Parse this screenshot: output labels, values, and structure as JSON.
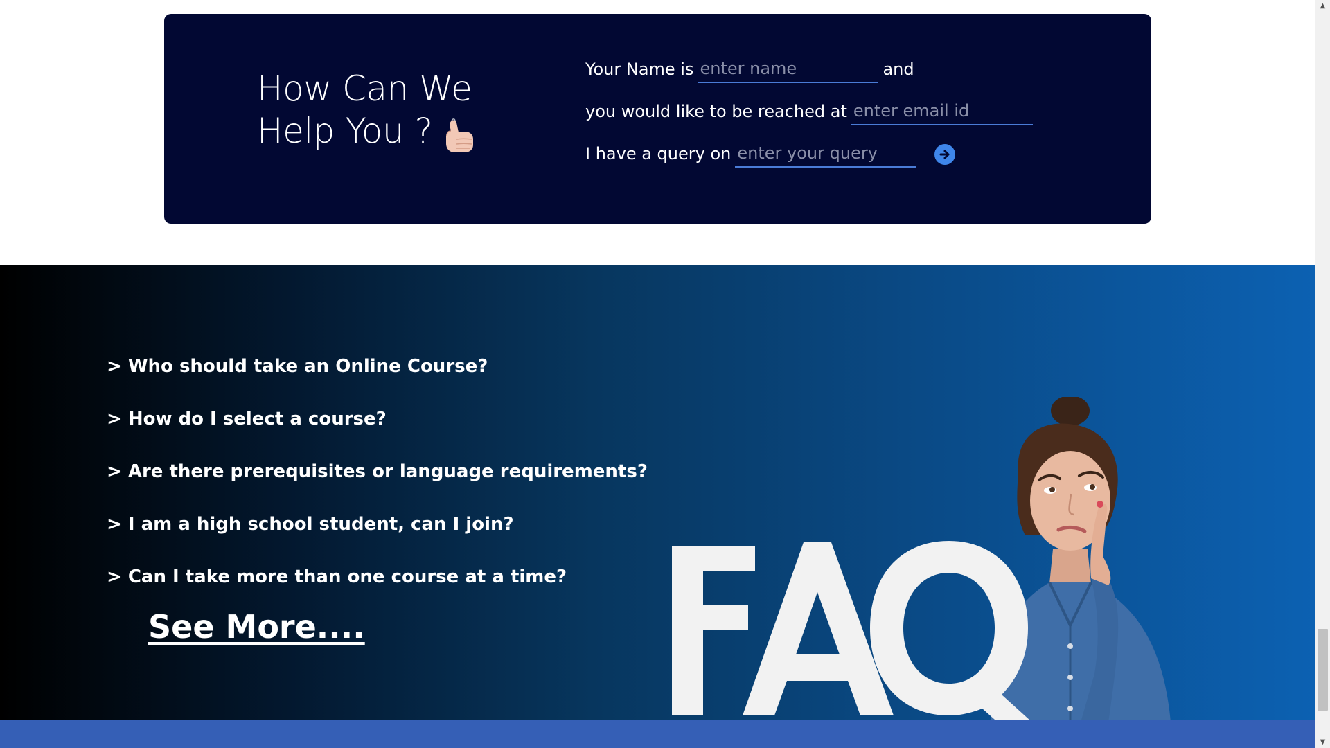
{
  "contact": {
    "heading_line1": "How Can We",
    "heading_line2": "Help You ?",
    "hand_icon": "call-me-hand-emoji",
    "name_prefix": "Your Name is",
    "name_placeholder": "enter name",
    "name_suffix": "and",
    "email_prefix": "you would like to be reached at",
    "email_placeholder": "enter email id",
    "query_prefix": "I have a query on",
    "query_placeholder": "enter your query",
    "submit_icon": "arrow-right-circle-icon",
    "card_color": "#020833",
    "underline_color": "#4a7bd6"
  },
  "faq": {
    "questions": [
      "> Who should take an Online Course?",
      "> How do I select a course?",
      "> Are there prerequisites or language requirements?",
      "> I am a high school student, can I join?",
      "> Can I take more than one course at a time?"
    ],
    "see_more": "See More....",
    "graphic_text": "FAQ",
    "gradient_start": "#000000",
    "gradient_end": "#0c61b2"
  },
  "footer": {
    "bar_color": "#355fb6"
  },
  "scrollbar": {
    "up_icon": "scroll-up-arrow-icon",
    "down_icon": "scroll-down-arrow-icon"
  }
}
